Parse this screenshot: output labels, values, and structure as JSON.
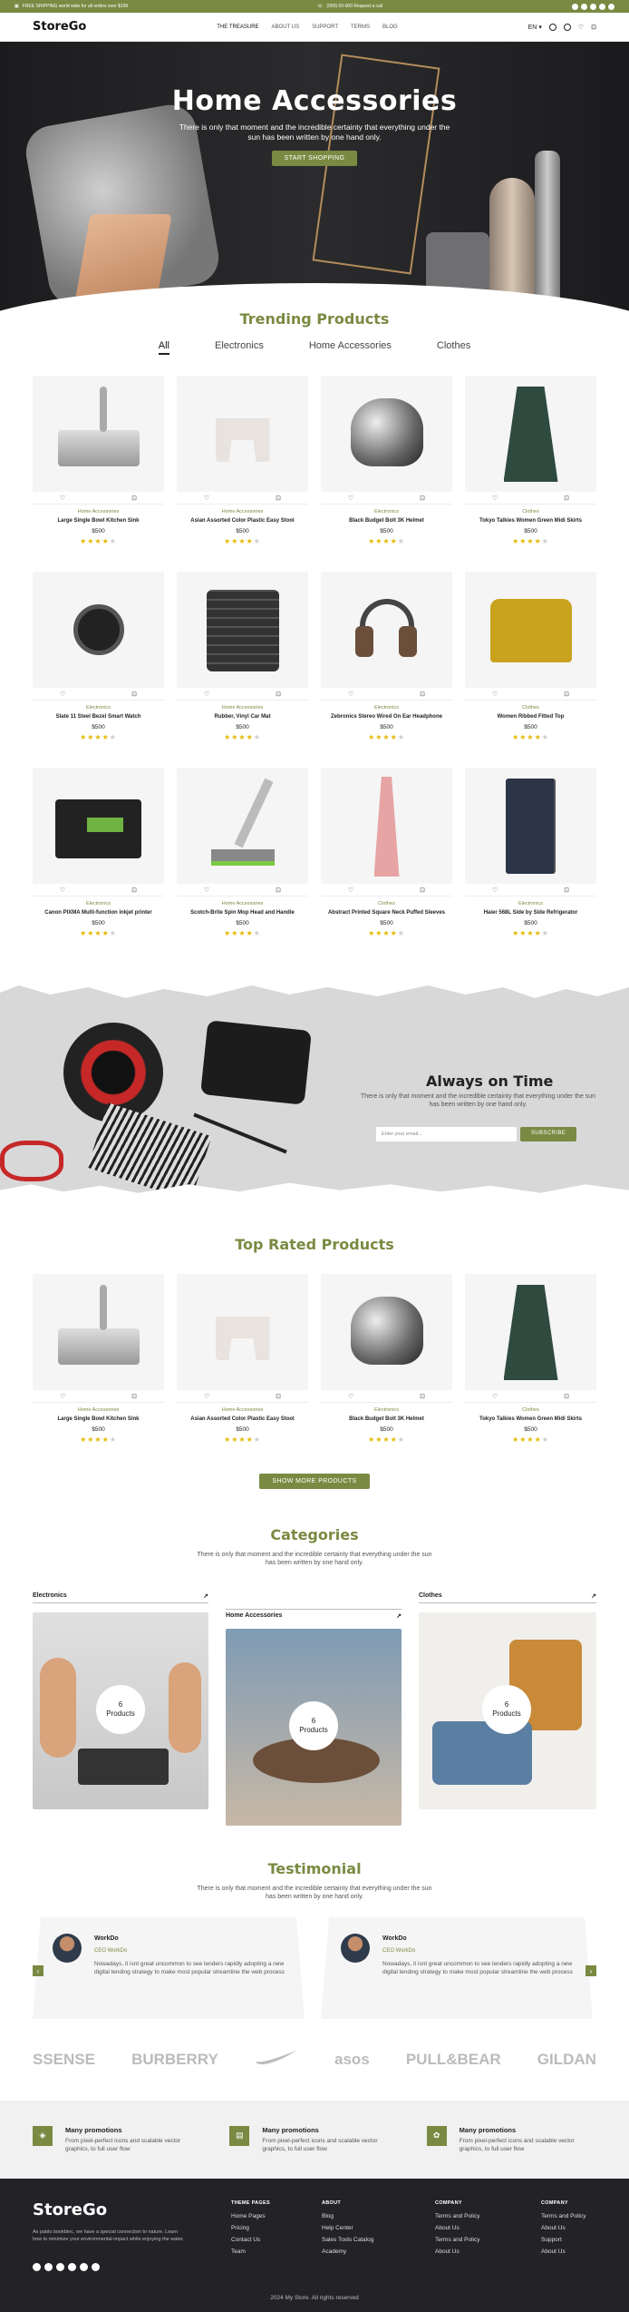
{
  "topbar": {
    "shipping": "FREE SHIPPING world wide for all orders over $199",
    "phone": "(000) 00-000 Request a call"
  },
  "nav": {
    "logo": "StoreGo",
    "items": [
      "THE TREASURE",
      "ABOUT US",
      "SUPPORT",
      "TERMS",
      "BLOG"
    ],
    "lang": "EN"
  },
  "hero": {
    "title": "Home Accessories",
    "subtitle": "There is only that moment and the incredible certainty that everything under the sun has been written by one hand only.",
    "button": "START SHOPPING"
  },
  "trending": {
    "title": "Trending Products",
    "tabs": [
      "All",
      "Electronics",
      "Home Accessories",
      "Clothes"
    ]
  },
  "products": [
    {
      "cat": "Home Accessories",
      "name": "Large Single Bowl Kitchen Sink",
      "price": "$500",
      "rating": 4
    },
    {
      "cat": "Home Accessories",
      "name": "Asian Assorted Color Plastic Easy Stool",
      "price": "$500",
      "rating": 4
    },
    {
      "cat": "Electronics",
      "name": "Black Budget Bolt 3K Helmet",
      "price": "$500",
      "rating": 4
    },
    {
      "cat": "Clothes",
      "name": "Tokyo Talkies Women Green Midi Skirts",
      "price": "$500",
      "rating": 4
    },
    {
      "cat": "Electronics",
      "name": "Slate 11 Steel Bezel Smart Watch",
      "price": "$500",
      "rating": 4
    },
    {
      "cat": "Home Accessories",
      "name": "Rubber, Vinyl Car Mat",
      "price": "$500",
      "rating": 4
    },
    {
      "cat": "Electronics",
      "name": "Zebronics Stereo Wired On Ear Headphone",
      "price": "$500",
      "rating": 4
    },
    {
      "cat": "Clothes",
      "name": "Women Ribbed Fitted Top",
      "price": "$500",
      "rating": 4
    },
    {
      "cat": "Electronics",
      "name": "Canon PIXMA Multi-function inkjet printer",
      "price": "$500",
      "rating": 4
    },
    {
      "cat": "Home Accessories",
      "name": "Scotch-Brite Spin Mop Head and Handle",
      "price": "$500",
      "rating": 4
    },
    {
      "cat": "Clothes",
      "name": "Abstract Printed Square Neck Puffed Sleeves",
      "price": "$500",
      "rating": 4
    },
    {
      "cat": "Electronics",
      "name": "Haier 568L Side by Side Refrigerator",
      "price": "$500",
      "rating": 4
    }
  ],
  "banner": {
    "title": "Always on Time",
    "text": "There is only that moment and the incredible certainty that everything under the sun has been written by one hand only.",
    "email_placeholder": "Enter your email...",
    "button": "SUBSCRIBE"
  },
  "top_rated": {
    "title": "Top Rated Products",
    "button": "SHOW MORE PRODUCTS"
  },
  "categories": {
    "title": "Categories",
    "text": "There is only that moment and the incredible certainty that everything under the sun has been written by one hand only.",
    "items": [
      {
        "name": "Electronics",
        "count": "6",
        "label": "Products"
      },
      {
        "name": "Home Accessories",
        "count": "6",
        "label": "Products"
      },
      {
        "name": "Clothes",
        "count": "6",
        "label": "Products"
      }
    ]
  },
  "testimonial": {
    "title": "Testimonial",
    "text": "There is only that moment and the incredible certainty that everything under the sun has been written by one hand only.",
    "items": [
      {
        "name": "WorkDo",
        "role": "CEO WorkDo",
        "quote": "Nowadays, it isnt great uncommon to see lenders rapidly adopting a new digital lending strategy to make most popular streamline the web process"
      },
      {
        "name": "WorkDo",
        "role": "CEO WorkDo",
        "quote": "Nowadays, it isnt great uncommon to see lenders rapidly adopting a new digital lending strategy to make most popular streamline the web process"
      }
    ]
  },
  "brands": [
    "SSENSE",
    "BURBERRY",
    "NIKE",
    "asos",
    "PULL&BEAR",
    "GILDAN"
  ],
  "promos": [
    {
      "title": "Many promotions",
      "text": "From pixel-perfect icons and scalable vector graphics, to full user flow"
    },
    {
      "title": "Many promotions",
      "text": "From pixel-perfect icons and scalable vector graphics, to full user flow"
    },
    {
      "title": "Many promotions",
      "text": "From pixel-perfect icons and scalable vector graphics, to full user flow"
    }
  ],
  "footer": {
    "logo": "StoreGo",
    "desc": "As pablo bookbinc, we have a special connection to nature. Learn how to minimize your environmental impact while enjoying the water.",
    "cols": [
      {
        "title": "THEME PAGES",
        "items": [
          "Home Pages",
          "Pricing",
          "Contact Us",
          "Team"
        ]
      },
      {
        "title": "ABOUT",
        "items": [
          "Blog",
          "Help Center",
          "Sales Tools Catalog",
          "Academy"
        ]
      },
      {
        "title": "COMPANY",
        "items": [
          "Terms and Policy",
          "About Us",
          "Terms and Policy",
          "About Us"
        ]
      },
      {
        "title": "COMPANY",
        "items": [
          "Terms and Policy",
          "About Us",
          "Support",
          "About Us"
        ]
      }
    ],
    "copyright": "2024 My Store. All rights reserved"
  },
  "colors": {
    "accent": "#7a8a42",
    "dark": "#232327",
    "star": "#e6b800"
  }
}
